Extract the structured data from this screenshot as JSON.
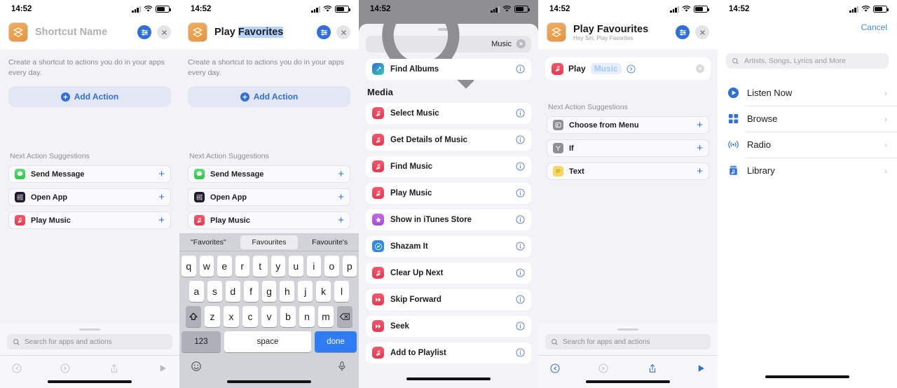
{
  "status_bar": {
    "time": "14:52",
    "icons": [
      "cellular-signal-icon",
      "wifi-icon",
      "battery-icon"
    ]
  },
  "panel1": {
    "title_placeholder": "Shortcut Name",
    "description": "Create a shortcut to actions you do in your apps every day.",
    "add_action_label": "Add Action",
    "suggestions_header": "Next Action Suggestions",
    "suggestions": [
      {
        "label": "Send Message",
        "icon": "messages-icon"
      },
      {
        "label": "Open App",
        "icon": "open-app-icon"
      },
      {
        "label": "Play Music",
        "icon": "music-icon"
      }
    ],
    "search_placeholder": "Search for apps and actions"
  },
  "panel2": {
    "title_part1": "Play ",
    "title_selected": "Favorites",
    "description": "Create a shortcut to actions you do in your apps every day.",
    "add_action_label": "Add Action",
    "suggestions_header": "Next Action Suggestions",
    "suggestions": [
      {
        "label": "Send Message",
        "icon": "messages-icon"
      },
      {
        "label": "Open App",
        "icon": "open-app-icon"
      },
      {
        "label": "Play Music",
        "icon": "music-icon"
      }
    ],
    "keyboard": {
      "predictions": [
        "\"Favorites\"",
        "Favourites",
        "Favourite's"
      ],
      "selected_prediction_index": 1,
      "row1": [
        "q",
        "w",
        "e",
        "r",
        "t",
        "y",
        "u",
        "i",
        "o",
        "p"
      ],
      "row2": [
        "a",
        "s",
        "d",
        "f",
        "g",
        "h",
        "j",
        "k",
        "l"
      ],
      "row3": [
        "z",
        "x",
        "c",
        "v",
        "b",
        "n",
        "m"
      ],
      "shift_key": "shift-icon",
      "backspace_key": "backspace-icon",
      "num_key": "123",
      "space_key": "space",
      "done_key": "done",
      "emoji_key": "emoji-icon",
      "mic_key": "microphone-icon"
    }
  },
  "panel3": {
    "search_value": "Music",
    "top_result": {
      "label": "Find Albums",
      "icon": "shortcuts-tool-icon"
    },
    "section_header": "Media",
    "results": [
      {
        "label": "Select Music",
        "icon": "music-icon"
      },
      {
        "label": "Get Details of Music",
        "icon": "music-icon"
      },
      {
        "label": "Find Music",
        "icon": "music-icon"
      },
      {
        "label": "Play Music",
        "icon": "music-icon"
      },
      {
        "label": "Show in iTunes Store",
        "icon": "star-icon"
      },
      {
        "label": "Shazam It",
        "icon": "shazam-icon"
      },
      {
        "label": "Clear Up Next",
        "icon": "music-icon"
      },
      {
        "label": "Skip Forward",
        "icon": "skip-forward-icon"
      },
      {
        "label": "Seek",
        "icon": "skip-forward-icon"
      },
      {
        "label": "Add to Playlist",
        "icon": "music-icon"
      }
    ]
  },
  "panel4": {
    "title": "Play Favourites",
    "subtitle": "Hey Siri, Play Favorites",
    "action": {
      "verb": "Play",
      "token": "Music",
      "icon": "music-icon"
    },
    "suggestions_header": "Next Action Suggestions",
    "suggestions": [
      {
        "label": "Choose from Menu",
        "icon": "menu-icon"
      },
      {
        "label": "If",
        "icon": "if-icon"
      },
      {
        "label": "Text",
        "icon": "text-icon"
      }
    ],
    "search_placeholder": "Search for apps and actions"
  },
  "panel5": {
    "cancel_label": "Cancel",
    "search_placeholder": "Artists, Songs, Lyrics and More",
    "items": [
      {
        "label": "Listen Now",
        "icon": "play-circle-icon"
      },
      {
        "label": "Browse",
        "icon": "grid-icon"
      },
      {
        "label": "Radio",
        "icon": "radio-waves-icon"
      },
      {
        "label": "Library",
        "icon": "library-icon"
      }
    ]
  },
  "colors": {
    "accent": "#2f6fd8",
    "music_red": "#e8374f",
    "shortcut_orange": "#e8933d",
    "done_blue": "#2f7cf6"
  }
}
